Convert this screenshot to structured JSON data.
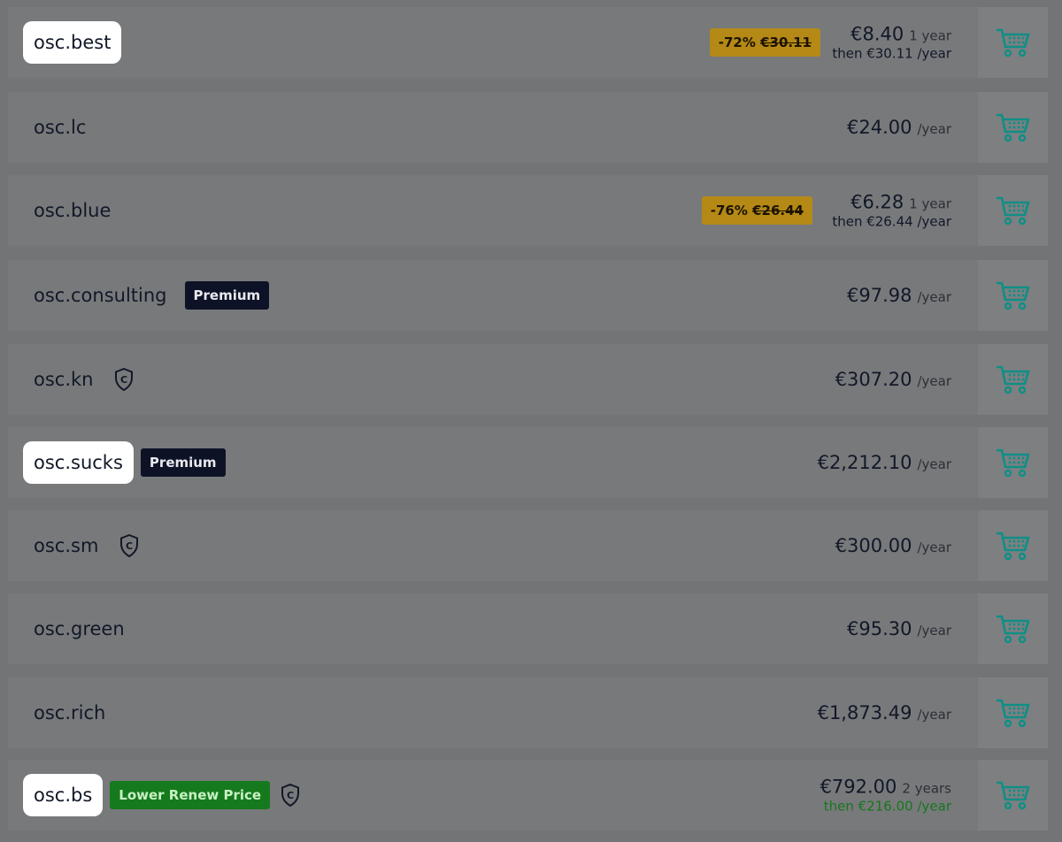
{
  "colors": {
    "background": "#737476",
    "row": "#78797b",
    "cart_cell": "#7e7f81",
    "cart_icon": "#0e8f86",
    "discount_badge": "#b58916",
    "premium_badge": "#0d1226",
    "renew_badge": "#157a1d",
    "renew_text_green": "#16771e"
  },
  "results": [
    {
      "domain": "osc.best",
      "highlight": true,
      "discount": {
        "pct": "-72%",
        "old": "€30.11"
      },
      "price": "€8.40",
      "unit": "1 year",
      "renew": "then €30.11 /year"
    },
    {
      "domain": "osc.lc",
      "price": "€24.00",
      "unit": "/year"
    },
    {
      "domain": "osc.blue",
      "discount": {
        "pct": "-76%",
        "old": "€26.44"
      },
      "price": "€6.28",
      "unit": "1 year",
      "renew": "then €26.44 /year"
    },
    {
      "domain": "osc.consulting",
      "badge": {
        "label": "Premium",
        "kind": "premium"
      },
      "price": "€97.98",
      "unit": "/year"
    },
    {
      "domain": "osc.kn",
      "shield": true,
      "price": "€307.20",
      "unit": "/year"
    },
    {
      "domain": "osc.sucks",
      "highlight": true,
      "badge": {
        "label": "Premium",
        "kind": "premium"
      },
      "price": "€2,212.10",
      "unit": "/year"
    },
    {
      "domain": "osc.sm",
      "shield": true,
      "price": "€300.00",
      "unit": "/year"
    },
    {
      "domain": "osc.green",
      "price": "€95.30",
      "unit": "/year"
    },
    {
      "domain": "osc.rich",
      "price": "€1,873.49",
      "unit": "/year"
    },
    {
      "domain": "osc.bs",
      "highlight": true,
      "badge": {
        "label": "Lower Renew Price",
        "kind": "renew"
      },
      "shield": true,
      "price": "€792.00",
      "unit": "2 years",
      "renew": "then €216.00 /year",
      "renew_green": true
    }
  ],
  "icons": {
    "cart": "shopping-cart-icon",
    "shield": "shield-c-icon"
  }
}
